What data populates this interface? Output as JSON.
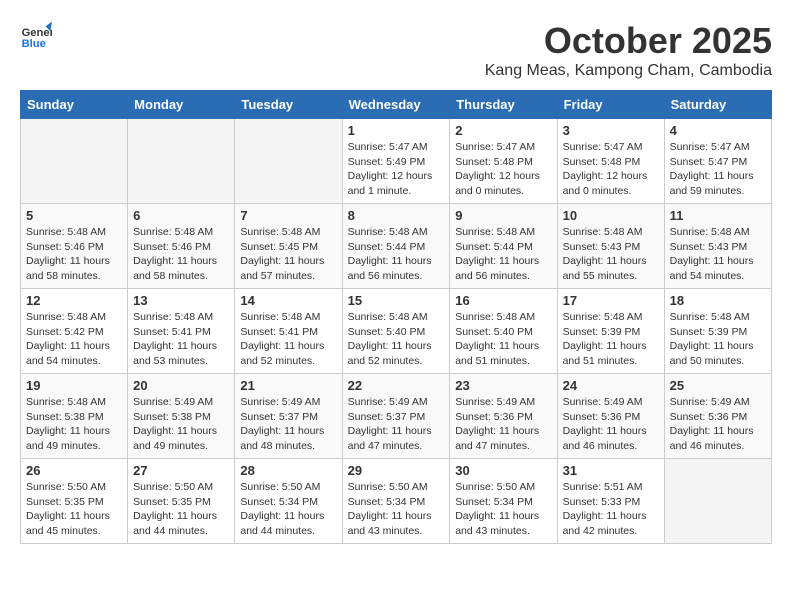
{
  "logo": {
    "line1": "General",
    "line2": "Blue"
  },
  "title": "October 2025",
  "subtitle": "Kang Meas, Kampong Cham, Cambodia",
  "headers": [
    "Sunday",
    "Monday",
    "Tuesday",
    "Wednesday",
    "Thursday",
    "Friday",
    "Saturday"
  ],
  "weeks": [
    [
      {
        "day": "",
        "info": ""
      },
      {
        "day": "",
        "info": ""
      },
      {
        "day": "",
        "info": ""
      },
      {
        "day": "1",
        "info": "Sunrise: 5:47 AM\nSunset: 5:49 PM\nDaylight: 12 hours\nand 1 minute."
      },
      {
        "day": "2",
        "info": "Sunrise: 5:47 AM\nSunset: 5:48 PM\nDaylight: 12 hours\nand 0 minutes."
      },
      {
        "day": "3",
        "info": "Sunrise: 5:47 AM\nSunset: 5:48 PM\nDaylight: 12 hours\nand 0 minutes."
      },
      {
        "day": "4",
        "info": "Sunrise: 5:47 AM\nSunset: 5:47 PM\nDaylight: 11 hours\nand 59 minutes."
      }
    ],
    [
      {
        "day": "5",
        "info": "Sunrise: 5:48 AM\nSunset: 5:46 PM\nDaylight: 11 hours\nand 58 minutes."
      },
      {
        "day": "6",
        "info": "Sunrise: 5:48 AM\nSunset: 5:46 PM\nDaylight: 11 hours\nand 58 minutes."
      },
      {
        "day": "7",
        "info": "Sunrise: 5:48 AM\nSunset: 5:45 PM\nDaylight: 11 hours\nand 57 minutes."
      },
      {
        "day": "8",
        "info": "Sunrise: 5:48 AM\nSunset: 5:44 PM\nDaylight: 11 hours\nand 56 minutes."
      },
      {
        "day": "9",
        "info": "Sunrise: 5:48 AM\nSunset: 5:44 PM\nDaylight: 11 hours\nand 56 minutes."
      },
      {
        "day": "10",
        "info": "Sunrise: 5:48 AM\nSunset: 5:43 PM\nDaylight: 11 hours\nand 55 minutes."
      },
      {
        "day": "11",
        "info": "Sunrise: 5:48 AM\nSunset: 5:43 PM\nDaylight: 11 hours\nand 54 minutes."
      }
    ],
    [
      {
        "day": "12",
        "info": "Sunrise: 5:48 AM\nSunset: 5:42 PM\nDaylight: 11 hours\nand 54 minutes."
      },
      {
        "day": "13",
        "info": "Sunrise: 5:48 AM\nSunset: 5:41 PM\nDaylight: 11 hours\nand 53 minutes."
      },
      {
        "day": "14",
        "info": "Sunrise: 5:48 AM\nSunset: 5:41 PM\nDaylight: 11 hours\nand 52 minutes."
      },
      {
        "day": "15",
        "info": "Sunrise: 5:48 AM\nSunset: 5:40 PM\nDaylight: 11 hours\nand 52 minutes."
      },
      {
        "day": "16",
        "info": "Sunrise: 5:48 AM\nSunset: 5:40 PM\nDaylight: 11 hours\nand 51 minutes."
      },
      {
        "day": "17",
        "info": "Sunrise: 5:48 AM\nSunset: 5:39 PM\nDaylight: 11 hours\nand 51 minutes."
      },
      {
        "day": "18",
        "info": "Sunrise: 5:48 AM\nSunset: 5:39 PM\nDaylight: 11 hours\nand 50 minutes."
      }
    ],
    [
      {
        "day": "19",
        "info": "Sunrise: 5:48 AM\nSunset: 5:38 PM\nDaylight: 11 hours\nand 49 minutes."
      },
      {
        "day": "20",
        "info": "Sunrise: 5:49 AM\nSunset: 5:38 PM\nDaylight: 11 hours\nand 49 minutes."
      },
      {
        "day": "21",
        "info": "Sunrise: 5:49 AM\nSunset: 5:37 PM\nDaylight: 11 hours\nand 48 minutes."
      },
      {
        "day": "22",
        "info": "Sunrise: 5:49 AM\nSunset: 5:37 PM\nDaylight: 11 hours\nand 47 minutes."
      },
      {
        "day": "23",
        "info": "Sunrise: 5:49 AM\nSunset: 5:36 PM\nDaylight: 11 hours\nand 47 minutes."
      },
      {
        "day": "24",
        "info": "Sunrise: 5:49 AM\nSunset: 5:36 PM\nDaylight: 11 hours\nand 46 minutes."
      },
      {
        "day": "25",
        "info": "Sunrise: 5:49 AM\nSunset: 5:36 PM\nDaylight: 11 hours\nand 46 minutes."
      }
    ],
    [
      {
        "day": "26",
        "info": "Sunrise: 5:50 AM\nSunset: 5:35 PM\nDaylight: 11 hours\nand 45 minutes."
      },
      {
        "day": "27",
        "info": "Sunrise: 5:50 AM\nSunset: 5:35 PM\nDaylight: 11 hours\nand 44 minutes."
      },
      {
        "day": "28",
        "info": "Sunrise: 5:50 AM\nSunset: 5:34 PM\nDaylight: 11 hours\nand 44 minutes."
      },
      {
        "day": "29",
        "info": "Sunrise: 5:50 AM\nSunset: 5:34 PM\nDaylight: 11 hours\nand 43 minutes."
      },
      {
        "day": "30",
        "info": "Sunrise: 5:50 AM\nSunset: 5:34 PM\nDaylight: 11 hours\nand 43 minutes."
      },
      {
        "day": "31",
        "info": "Sunrise: 5:51 AM\nSunset: 5:33 PM\nDaylight: 11 hours\nand 42 minutes."
      },
      {
        "day": "",
        "info": ""
      }
    ]
  ]
}
